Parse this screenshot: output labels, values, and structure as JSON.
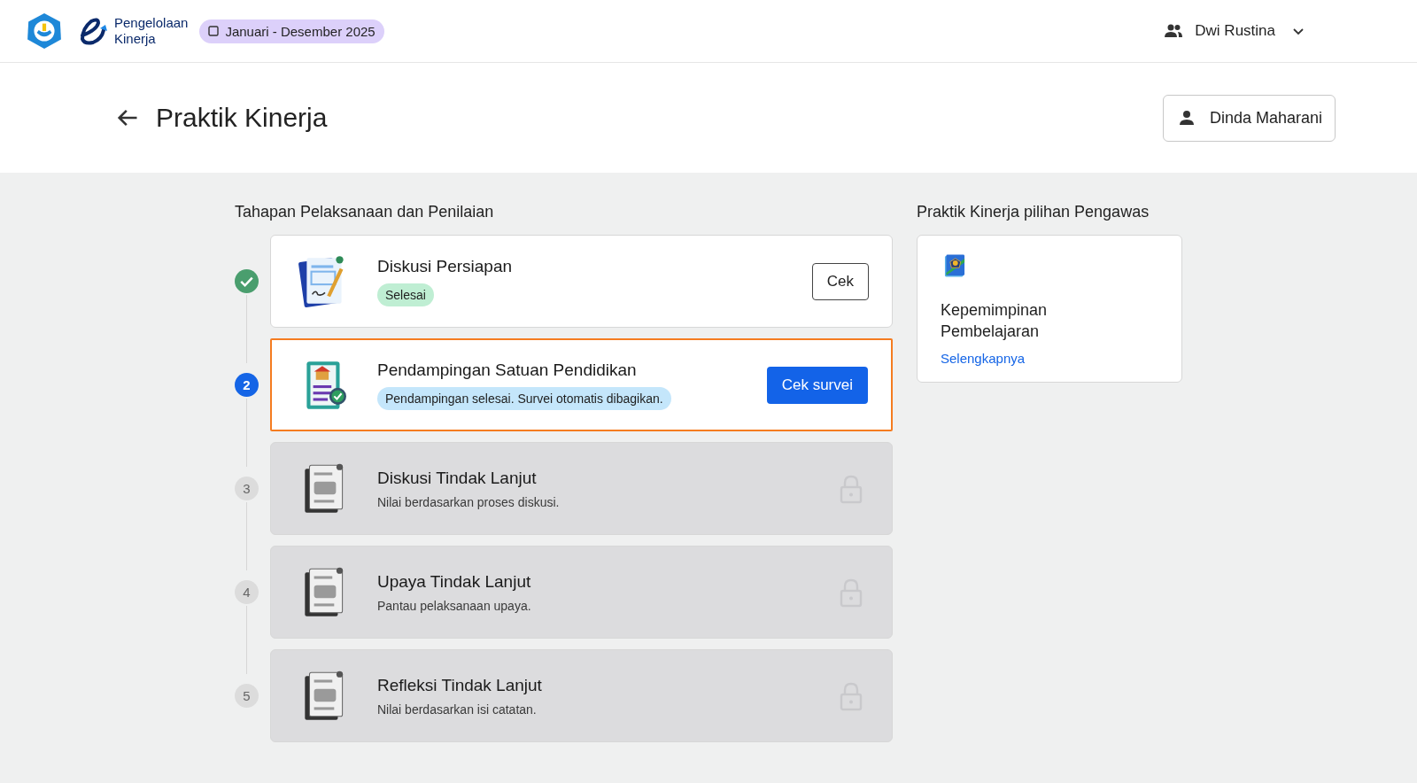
{
  "header": {
    "logo_lines": [
      "Pengelolaan",
      "Kinerja"
    ],
    "period": "Januari - Desember 2025",
    "user": "Dwi Rustina"
  },
  "page": {
    "title": "Praktik Kinerja",
    "person": "Dinda Maharani"
  },
  "stages": {
    "heading": "Tahapan Pelaksanaan dan Penilaian",
    "items": [
      {
        "title": "Diskusi Persiapan",
        "kind": "done",
        "selected": false,
        "badge": "Selesai",
        "button": "Cek"
      },
      {
        "number": "2",
        "title": "Pendampingan Satuan Pendidikan",
        "kind": "active",
        "selected": true,
        "badge": "Pendampingan selesai. Survei otomatis dibagikan.",
        "button": "Cek survei"
      },
      {
        "number": "3",
        "title": "Diskusi Tindak Lanjut",
        "kind": "locked",
        "selected": false,
        "description": "Nilai berdasarkan proses diskusi."
      },
      {
        "number": "4",
        "title": "Upaya Tindak Lanjut",
        "kind": "locked",
        "selected": false,
        "description": "Pantau pelaksanaan upaya."
      },
      {
        "number": "5",
        "title": "Refleksi Tindak Lanjut",
        "kind": "locked",
        "selected": false,
        "description": "Nilai berdasarkan isi catatan."
      }
    ]
  },
  "side": {
    "heading": "Praktik Kinerja pilihan Pengawas",
    "card": {
      "title": "Kepemimpinan Pembelajaran",
      "link": "Selengkapnya"
    }
  }
}
